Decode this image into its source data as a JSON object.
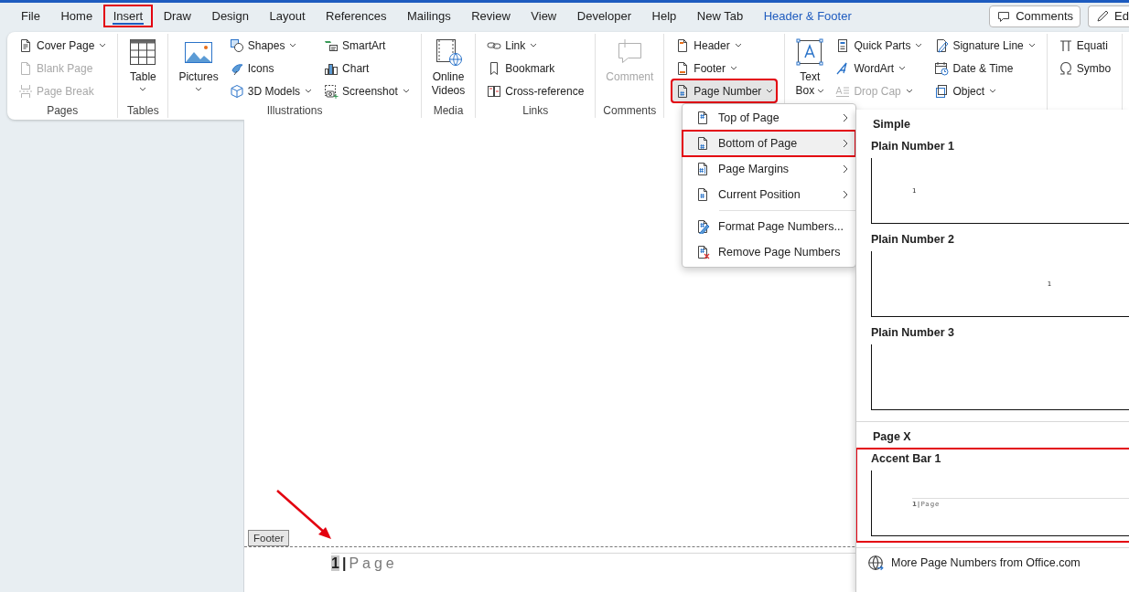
{
  "tabs": [
    {
      "label": "File",
      "selected": false,
      "annotated": false,
      "contextual": false
    },
    {
      "label": "Home",
      "selected": false,
      "annotated": false,
      "contextual": false
    },
    {
      "label": "Insert",
      "selected": true,
      "annotated": true,
      "contextual": false
    },
    {
      "label": "Draw",
      "selected": false,
      "annotated": false,
      "contextual": false
    },
    {
      "label": "Design",
      "selected": false,
      "annotated": false,
      "contextual": false
    },
    {
      "label": "Layout",
      "selected": false,
      "annotated": false,
      "contextual": false
    },
    {
      "label": "References",
      "selected": false,
      "annotated": false,
      "contextual": false
    },
    {
      "label": "Mailings",
      "selected": false,
      "annotated": false,
      "contextual": false
    },
    {
      "label": "Review",
      "selected": false,
      "annotated": false,
      "contextual": false
    },
    {
      "label": "View",
      "selected": false,
      "annotated": false,
      "contextual": false
    },
    {
      "label": "Developer",
      "selected": false,
      "annotated": false,
      "contextual": false
    },
    {
      "label": "Help",
      "selected": false,
      "annotated": false,
      "contextual": false
    },
    {
      "label": "New Tab",
      "selected": false,
      "annotated": false,
      "contextual": false
    },
    {
      "label": "Header & Footer",
      "selected": false,
      "annotated": false,
      "contextual": true
    }
  ],
  "top_buttons": [
    {
      "label": "Comments"
    },
    {
      "label": "Ed"
    }
  ],
  "ribbon": {
    "groups": [
      {
        "label": "Pages",
        "columns": [
          {
            "kind": "stack",
            "items": [
              {
                "label": "Cover Page",
                "caret": true,
                "disabled": false,
                "open": false,
                "annotated": false
              },
              {
                "label": "Blank Page",
                "caret": false,
                "disabled": true,
                "open": false,
                "annotated": false
              },
              {
                "label": "Page Break",
                "caret": false,
                "disabled": true,
                "open": false,
                "annotated": false
              }
            ]
          }
        ]
      },
      {
        "label": "Tables",
        "columns": [
          {
            "kind": "large",
            "lines": [
              "Table"
            ],
            "caret": true,
            "disabled": false
          }
        ]
      },
      {
        "label": "Illustrations",
        "columns": [
          {
            "kind": "large",
            "lines": [
              "Pictures"
            ],
            "caret": true,
            "disabled": false
          },
          {
            "kind": "stack",
            "items": [
              {
                "label": "Shapes",
                "caret": true,
                "disabled": false,
                "open": false,
                "annotated": false
              },
              {
                "label": "Icons",
                "caret": false,
                "disabled": false,
                "open": false,
                "annotated": false
              },
              {
                "label": "3D Models",
                "caret": true,
                "disabled": false,
                "open": false,
                "annotated": false
              }
            ]
          },
          {
            "kind": "stack",
            "items": [
              {
                "label": "SmartArt",
                "caret": false,
                "disabled": false,
                "open": false,
                "annotated": false
              },
              {
                "label": "Chart",
                "caret": false,
                "disabled": false,
                "open": false,
                "annotated": false
              },
              {
                "label": "Screenshot",
                "caret": true,
                "disabled": false,
                "open": false,
                "annotated": false
              }
            ]
          }
        ]
      },
      {
        "label": "Media",
        "columns": [
          {
            "kind": "large",
            "lines": [
              "Online",
              "Videos"
            ],
            "caret": false,
            "disabled": false
          }
        ]
      },
      {
        "label": "Links",
        "columns": [
          {
            "kind": "stack",
            "items": [
              {
                "label": "Link",
                "caret": true,
                "disabled": false,
                "open": false,
                "annotated": false
              },
              {
                "label": "Bookmark",
                "caret": false,
                "disabled": false,
                "open": false,
                "annotated": false
              },
              {
                "label": "Cross-reference",
                "caret": false,
                "disabled": false,
                "open": false,
                "annotated": false
              }
            ]
          }
        ]
      },
      {
        "label": "Comments",
        "columns": [
          {
            "kind": "large",
            "lines": [
              "Comment"
            ],
            "caret": false,
            "disabled": true
          }
        ]
      },
      {
        "columns": [
          {
            "kind": "stack",
            "items": [
              {
                "label": "Header",
                "caret": true,
                "disabled": false,
                "open": false,
                "annotated": false
              },
              {
                "label": "Footer",
                "caret": true,
                "disabled": false,
                "open": false,
                "annotated": false
              },
              {
                "label": "Page Number",
                "caret": true,
                "disabled": false,
                "open": true,
                "annotated": true
              }
            ]
          }
        ]
      },
      {
        "columns": [
          {
            "kind": "large",
            "lines": [
              "Text",
              "Box"
            ],
            "caret": true,
            "disabled": false
          },
          {
            "kind": "stack",
            "items": [
              {
                "label": "Quick Parts",
                "caret": true,
                "disabled": false,
                "open": false,
                "annotated": false
              },
              {
                "label": "WordArt",
                "caret": true,
                "disabled": false,
                "open": false,
                "annotated": false
              },
              {
                "label": "Drop Cap",
                "caret": true,
                "disabled": true,
                "open": false,
                "annotated": false
              }
            ]
          },
          {
            "kind": "stack",
            "items": [
              {
                "label": "Signature Line",
                "caret": true,
                "disabled": false,
                "open": false,
                "annotated": false
              },
              {
                "label": "Date & Time",
                "caret": false,
                "disabled": false,
                "open": false,
                "annotated": false
              },
              {
                "label": "Object",
                "caret": true,
                "disabled": false,
                "open": false,
                "annotated": false
              }
            ]
          }
        ]
      },
      {
        "columns": [
          {
            "kind": "stack",
            "items": [
              {
                "label": "Equati",
                "caret": false,
                "disabled": false,
                "open": false,
                "annotated": false
              },
              {
                "label": "Symbo",
                "caret": false,
                "disabled": false,
                "open": false,
                "annotated": false
              }
            ]
          }
        ]
      }
    ]
  },
  "page_number_menu": {
    "items": [
      {
        "kind": "item",
        "label": "Top of Page",
        "submenu": true,
        "selected": false,
        "annotated": false
      },
      {
        "kind": "item",
        "label": "Bottom of Page",
        "submenu": true,
        "selected": true,
        "annotated": true
      },
      {
        "kind": "item",
        "label": "Page Margins",
        "submenu": true,
        "selected": false,
        "annotated": false
      },
      {
        "kind": "item",
        "label": "Current Position",
        "submenu": true,
        "selected": false,
        "annotated": false
      },
      {
        "kind": "separator"
      },
      {
        "kind": "item",
        "label": "Format Page Numbers...",
        "submenu": false,
        "selected": false,
        "annotated": false
      },
      {
        "kind": "item",
        "label": "Remove Page Numbers",
        "submenu": false,
        "selected": false,
        "annotated": false
      }
    ]
  },
  "gallery": {
    "entries": [
      {
        "kind": "heading",
        "label": "Simple"
      },
      {
        "kind": "preview",
        "label": "Plain Number 1",
        "preview_text": "1",
        "annotated": false
      },
      {
        "kind": "preview",
        "label": "Plain Number 2",
        "preview_text": "1",
        "annotated": false
      },
      {
        "kind": "preview",
        "label": "Plain Number 3",
        "annotated": false
      },
      {
        "kind": "separator"
      },
      {
        "kind": "heading",
        "label": "Page X"
      },
      {
        "kind": "accent_preview",
        "label": "Accent Bar 1",
        "preview_text": "**1|**Page",
        "annotated": true
      },
      {
        "kind": "separator"
      },
      {
        "kind": "link",
        "label": "More Page Numbers from Office.com"
      }
    ]
  },
  "document": {
    "footer": {
      "label": "Footer",
      "page_number": "1",
      "separator": "|",
      "word": "Page"
    }
  }
}
